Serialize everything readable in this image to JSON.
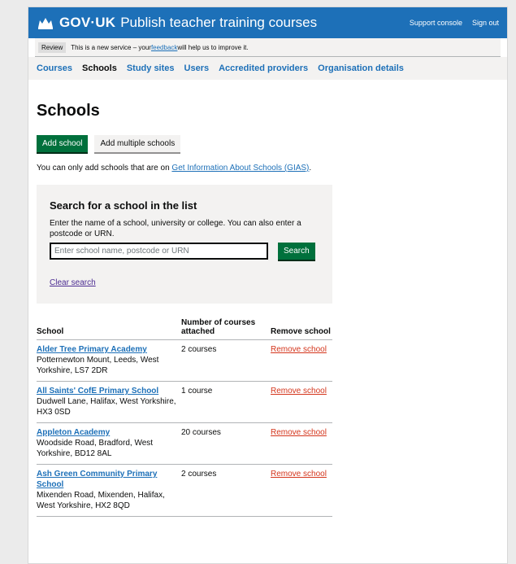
{
  "header": {
    "logo": "GOV·UK",
    "service": "Publish teacher training courses",
    "links": [
      "Support console",
      "Sign out"
    ]
  },
  "phase_banner": {
    "tag": "Review",
    "text_before": "This is a new service – your ",
    "link": "feedback",
    "text_after": " will help us to improve it."
  },
  "nav": {
    "items": [
      "Courses",
      "Schools",
      "Study sites",
      "Users",
      "Accredited providers",
      "Organisation details"
    ],
    "active": "Schools"
  },
  "page": {
    "title": "Schools",
    "add_school": "Add school",
    "add_multiple": "Add multiple schools",
    "note_before": "You can only add schools that are on ",
    "note_link": "Get Information About Schools (GIAS)",
    "note_after": "."
  },
  "search": {
    "heading": "Search for a school in the list",
    "hint": "Enter the name of a school, university or college. You can also enter a postcode or URN.",
    "placeholder": "Enter school name, postcode or URN",
    "button": "Search",
    "clear": "Clear search"
  },
  "table": {
    "headers": [
      "School",
      "Number of courses attached",
      "Remove school"
    ],
    "rows": [
      {
        "name": "Alder Tree Primary Academy",
        "address": "Potternewton Mount, Leeds, West Yorkshire, LS7 2DR",
        "courses": "2 courses",
        "action": "Remove school"
      },
      {
        "name": "All Saints' CofE Primary School",
        "address": "Dudwell Lane, Halifax, West Yorkshire, HX3 0SD",
        "courses": "1 course",
        "action": "Remove school"
      },
      {
        "name": "Appleton Academy",
        "address": "Woodside Road, Bradford, West Yorkshire, BD12 8AL",
        "courses": "20 courses",
        "action": "Remove school"
      },
      {
        "name": "Ash Green Community Primary School",
        "address": "Mixenden Road, Mixenden, Halifax, West Yorkshire, HX2 8QD",
        "courses": "2 courses",
        "action": "Remove school"
      }
    ]
  }
}
